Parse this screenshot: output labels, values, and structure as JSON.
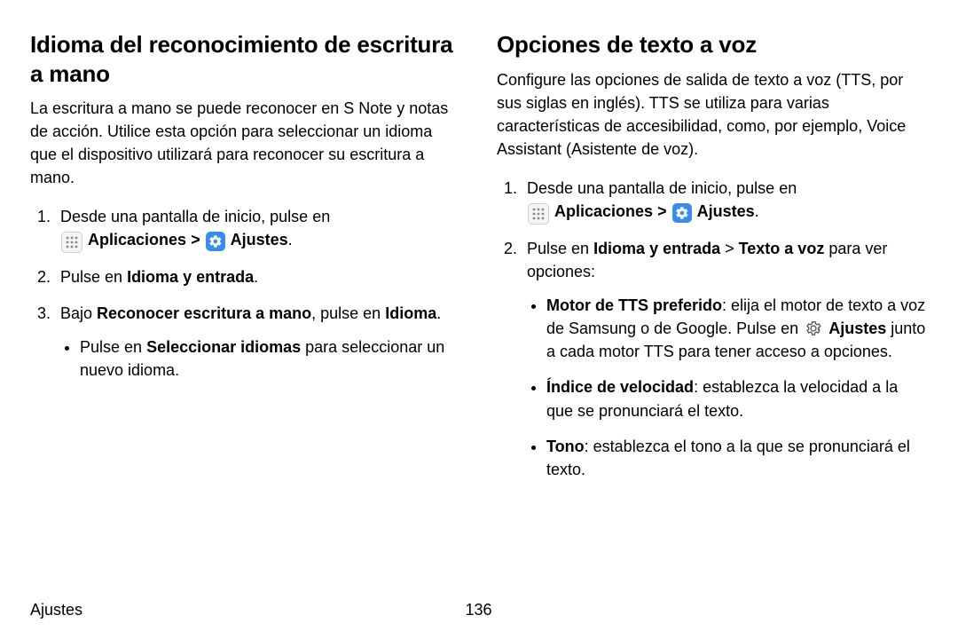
{
  "left": {
    "heading": "Idioma del reconocimiento de escritura a mano",
    "intro": "La escritura a mano se puede reconocer en S Note y notas de acción. Utilice esta opción para seleccionar un idioma que el dispositivo utilizará para reconocer su escritura a mano.",
    "step1_a": "Desde una pantalla de inicio, pulse en ",
    "apps_label": "Aplicaciones",
    "chevron": " > ",
    "ajustes_label": "Ajustes",
    "period": ".",
    "step2_a": "Pulse en ",
    "step2_b": "Idioma y entrada",
    "step3_a": "Bajo ",
    "step3_b": "Reconocer escritura a mano",
    "step3_c": ", pulse en ",
    "step3_d": "Idioma",
    "bullet1_a": "Pulse en ",
    "bullet1_b": "Seleccionar idiomas",
    "bullet1_c": " para seleccionar un nuevo idioma."
  },
  "right": {
    "heading": "Opciones de texto a voz",
    "intro": "Configure las opciones de salida de texto a voz (TTS, por sus siglas en inglés). TTS se utiliza para varias características de accesibilidad, como, por ejemplo, Voice Assistant (Asistente de voz).",
    "step1_a": "Desde una pantalla de inicio, pulse en ",
    "apps_label": "Aplicaciones",
    "chevron": " > ",
    "ajustes_label": "Ajustes",
    "period": ".",
    "step2_a": "Pulse en ",
    "step2_b": "Idioma y entrada",
    "step2_c": " > ",
    "step2_d": "Texto a voz",
    "step2_e": " para ver opciones:",
    "b1_a": "Motor de TTS preferido",
    "b1_b": ": elija el motor de texto a voz de Samsung o de Google. Pulse en ",
    "b1_c": "Ajustes",
    "b1_d": " junto a cada motor TTS para tener acceso a opciones.",
    "b2_a": "Índice de velocidad",
    "b2_b": ": establezca la velocidad a la que se pronunciará el texto.",
    "b3_a": "Tono",
    "b3_b": ": establezca el tono a la que se pronunciará el texto."
  },
  "footer": {
    "section": "Ajustes",
    "page": "136"
  }
}
